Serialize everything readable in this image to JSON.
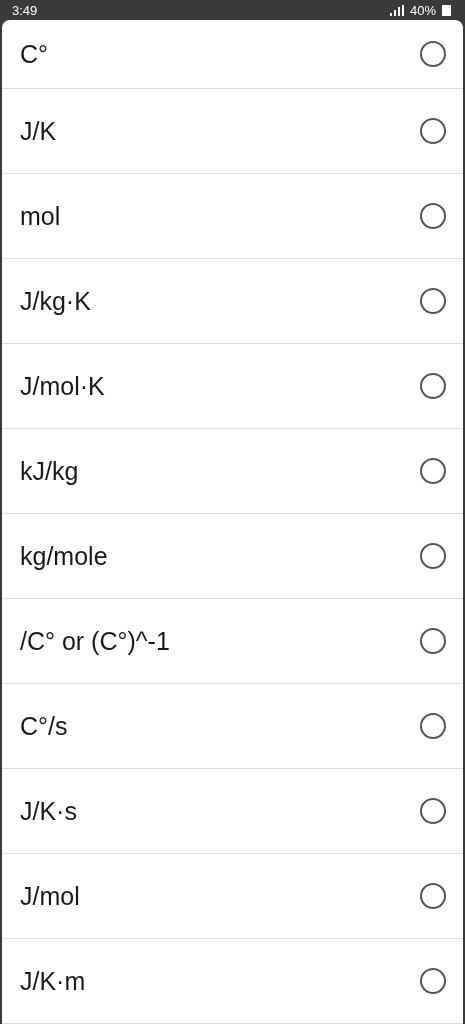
{
  "status_bar": {
    "time": "3:49",
    "battery": "40%"
  },
  "options": [
    {
      "label": "C°",
      "selected": false
    },
    {
      "label": "J/K",
      "selected": false
    },
    {
      "label": "mol",
      "selected": false
    },
    {
      "label": "J/kg·K",
      "selected": false
    },
    {
      "label": "J/mol·K",
      "selected": false
    },
    {
      "label": "kJ/kg",
      "selected": false
    },
    {
      "label": "kg/mole",
      "selected": false
    },
    {
      "label": "/C° or (C°)^-1",
      "selected": false
    },
    {
      "label": "C°/s",
      "selected": false
    },
    {
      "label": "J/K·s",
      "selected": false
    },
    {
      "label": "J/mol",
      "selected": false
    },
    {
      "label": "J/K·m",
      "selected": false
    }
  ]
}
